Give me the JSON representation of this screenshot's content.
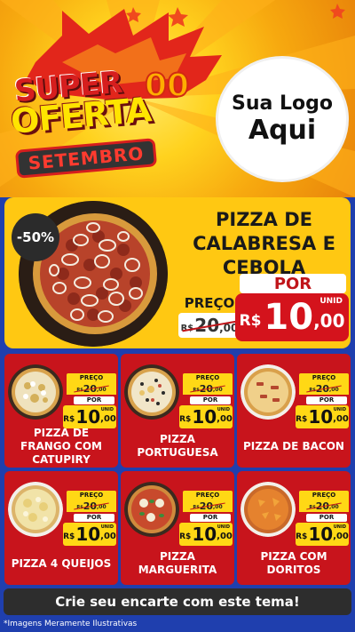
{
  "header": {
    "title_line1": "SUPER",
    "title_line2": "OFERTA",
    "title_line3": "SETEMBRO",
    "logo_line1": "Sua Logo",
    "logo_line2": "Aqui"
  },
  "featured": {
    "discount": "-50%",
    "name": "PIZZA DE CALABRESA E CEBOLA",
    "old_label": "PREÇO",
    "old_currency": "R$",
    "old_int": "20",
    "old_dec": ",00",
    "new_label": "POR",
    "new_currency": "R$",
    "new_int": "10",
    "new_dec": ",00",
    "unit": "UNID"
  },
  "products": [
    {
      "name": "PIZZA DE FRANGO COM CATUPIRY",
      "old_label": "PREÇO",
      "old_currency": "R$",
      "old_int": "20",
      "old_dec": ",00",
      "new_label": "POR",
      "new_currency": "R$",
      "new_int": "10",
      "new_dec": ",00",
      "unit": "UNID"
    },
    {
      "name": "PIZZA PORTUGUESA",
      "old_label": "PREÇO",
      "old_currency": "R$",
      "old_int": "20",
      "old_dec": ",00",
      "new_label": "POR",
      "new_currency": "R$",
      "new_int": "10",
      "new_dec": ",00",
      "unit": "UNID"
    },
    {
      "name": "PIZZA DE BACON",
      "old_label": "PREÇO",
      "old_currency": "R$",
      "old_int": "20",
      "old_dec": ",00",
      "new_label": "POR",
      "new_currency": "R$",
      "new_int": "10",
      "new_dec": ",00",
      "unit": "UNID"
    },
    {
      "name": "PIZZA 4 QUEIJOS",
      "old_label": "PREÇO",
      "old_currency": "R$",
      "old_int": "20",
      "old_dec": ",00",
      "new_label": "POR",
      "new_currency": "R$",
      "new_int": "10",
      "new_dec": ",00",
      "unit": "UNID"
    },
    {
      "name": "PIZZA MARGUERITA",
      "old_label": "PREÇO",
      "old_currency": "R$",
      "old_int": "20",
      "old_dec": ",00",
      "new_label": "POR",
      "new_currency": "R$",
      "new_int": "10",
      "new_dec": ",00",
      "unit": "UNID"
    },
    {
      "name": "PIZZA COM DORITOS",
      "old_label": "PREÇO",
      "old_currency": "R$",
      "old_int": "20",
      "old_dec": ",00",
      "new_label": "POR",
      "new_currency": "R$",
      "new_int": "10",
      "new_dec": ",00",
      "unit": "UNID"
    }
  ],
  "footer": {
    "cta": "Crie seu encarte com este tema!",
    "disclaimer": "*Imagens Meramente Ilustrativas"
  },
  "colors": {
    "background": "#1f3fae",
    "card": "#c8141c",
    "featured": "#ffc812",
    "price_tag": "#ffd815"
  }
}
